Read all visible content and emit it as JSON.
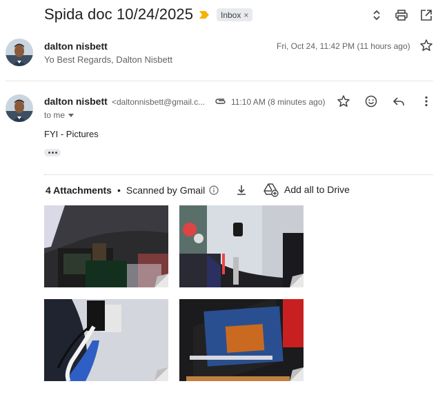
{
  "thread": {
    "subject": "Spida doc 10/24/2025",
    "label": "Inbox"
  },
  "message1": {
    "sender": "dalton nisbett",
    "snippet": "Yo Best Regards, Dalton Nisbett",
    "date": "Fri, Oct 24, 11:42 PM (11 hours ago)"
  },
  "message2": {
    "sender": "dalton nisbett",
    "email": "<daltonnisbett@gmail.c...",
    "date": "11:10 AM (8 minutes ago)",
    "recipient": "to me",
    "body": "FYI - Pictures"
  },
  "attachments": {
    "count_label": "4 Attachments",
    "separator": "•",
    "scanned_label": "Scanned by Gmail",
    "drive_label": "Add all to Drive"
  },
  "colors": {
    "important_marker": "#f4b400",
    "text_primary": "#1f1f1f",
    "text_secondary": "#5f6368"
  }
}
